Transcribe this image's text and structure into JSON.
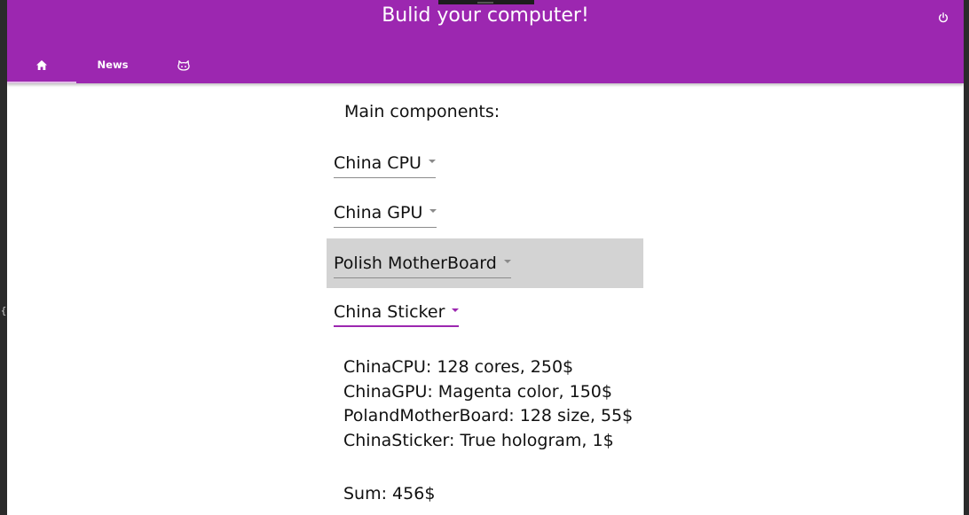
{
  "app": {
    "title": "Bulid your computer!"
  },
  "tabs": [
    {
      "label": "",
      "icon": "home-icon",
      "active": true
    },
    {
      "label": "News",
      "icon": "",
      "active": false
    },
    {
      "label": "",
      "icon": "github-octocat-icon",
      "active": false
    }
  ],
  "main": {
    "section_title": "Main components:",
    "selects": [
      {
        "value": "China CPU"
      },
      {
        "value": "China GPU"
      },
      {
        "value": "Polish MotherBoard"
      },
      {
        "value": "China Sticker"
      }
    ],
    "details": [
      "ChinaCPU: 128 cores, 250$",
      "ChinaGPU: Magenta color, 150$",
      "PolandMotherBoard: 128 size, 55$",
      "ChinaSticker: True hologram, 1$"
    ],
    "sum": "Sum: 456$"
  },
  "colors": {
    "appbar": "#9c27b0",
    "accent": "#9c27b0",
    "hover_row": "#d3d3d3"
  },
  "icons": {
    "power": "power-icon",
    "home": "home-icon",
    "octocat": "github-octocat-icon"
  },
  "side_glyph": "{"
}
